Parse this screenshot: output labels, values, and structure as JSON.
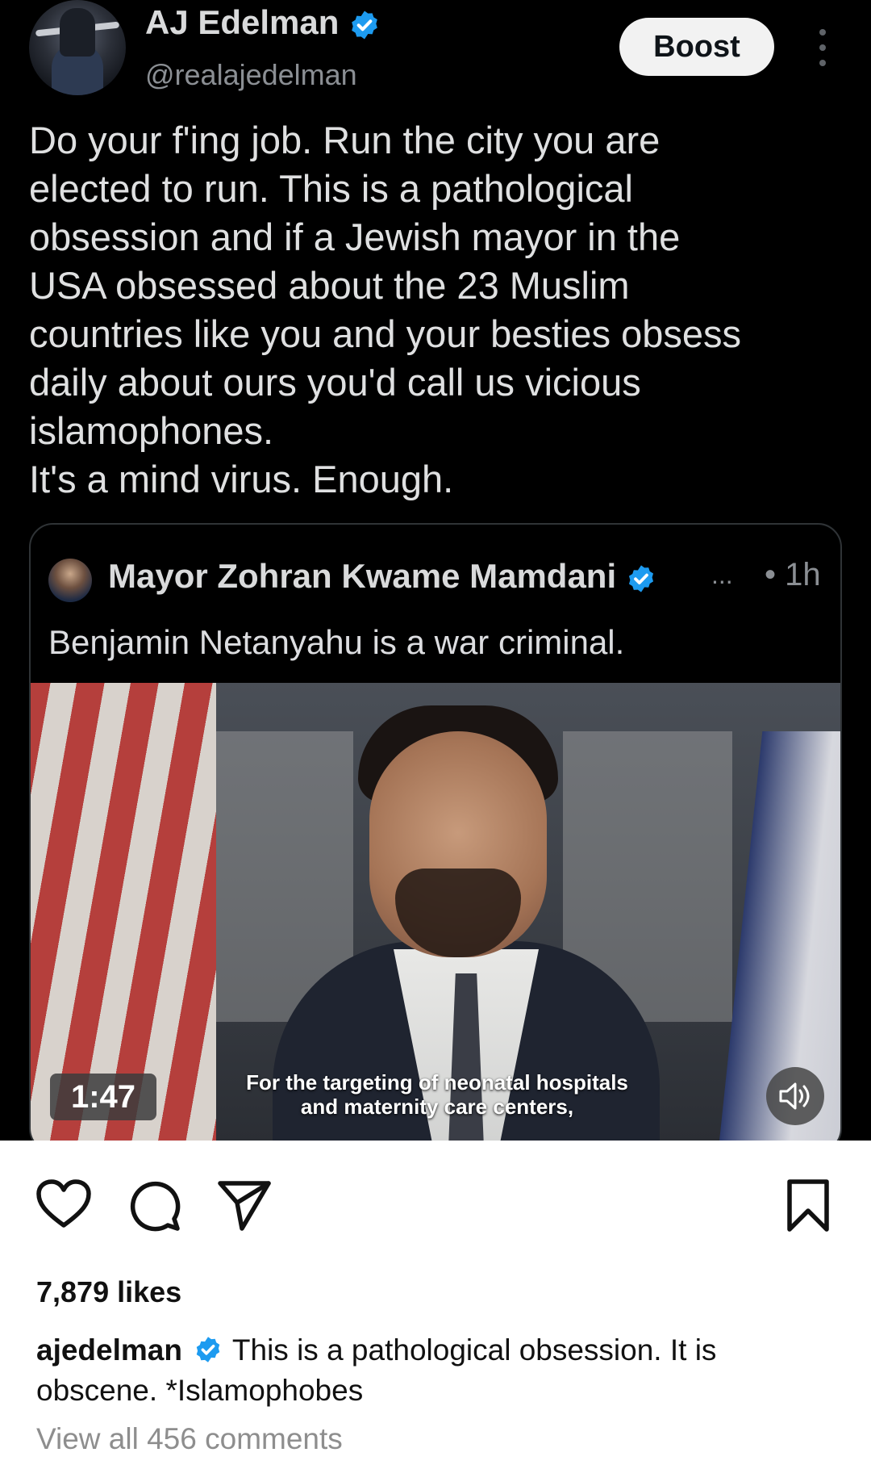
{
  "tweet": {
    "author_name": "AJ Edelman",
    "author_handle": "@realajedelman",
    "boost_label": "Boost",
    "text_lines": [
      "Do your f'ing job. Run the city you are",
      "elected to run. This is a pathological",
      "obsession and if a Jewish mayor in the",
      "USA obsessed about the 23 Muslim",
      "countries like you and your besties obsess",
      "daily about ours you'd call us vicious",
      "islamophones.",
      "It's a mind virus. Enough."
    ],
    "quote": {
      "author_name": "Mayor Zohran Kwame Mamdani",
      "ellipsis": "...",
      "time": "• 1h",
      "text": "Benjamin Netanyahu is a war criminal.",
      "video": {
        "subtitle_line1": "For the targeting of neonatal hospitals",
        "subtitle_line2": "and maternity care centers,",
        "duration": "1:47",
        "volume_icon": "speaker-icon"
      }
    }
  },
  "post": {
    "actions": {
      "like_icon": "heart-icon",
      "comment_icon": "comment-icon",
      "share_icon": "send-icon",
      "save_icon": "bookmark-icon"
    },
    "likes": "7,879 likes",
    "caption_user": "ajedelman",
    "caption_text": "This is a pathological obsession. It is obscene. *Islamophobes",
    "view_comments": "View all 456 comments"
  },
  "colors": {
    "verified_blue": "#1d9bf0",
    "tweet_background": "#000000",
    "post_background": "#ffffff"
  }
}
